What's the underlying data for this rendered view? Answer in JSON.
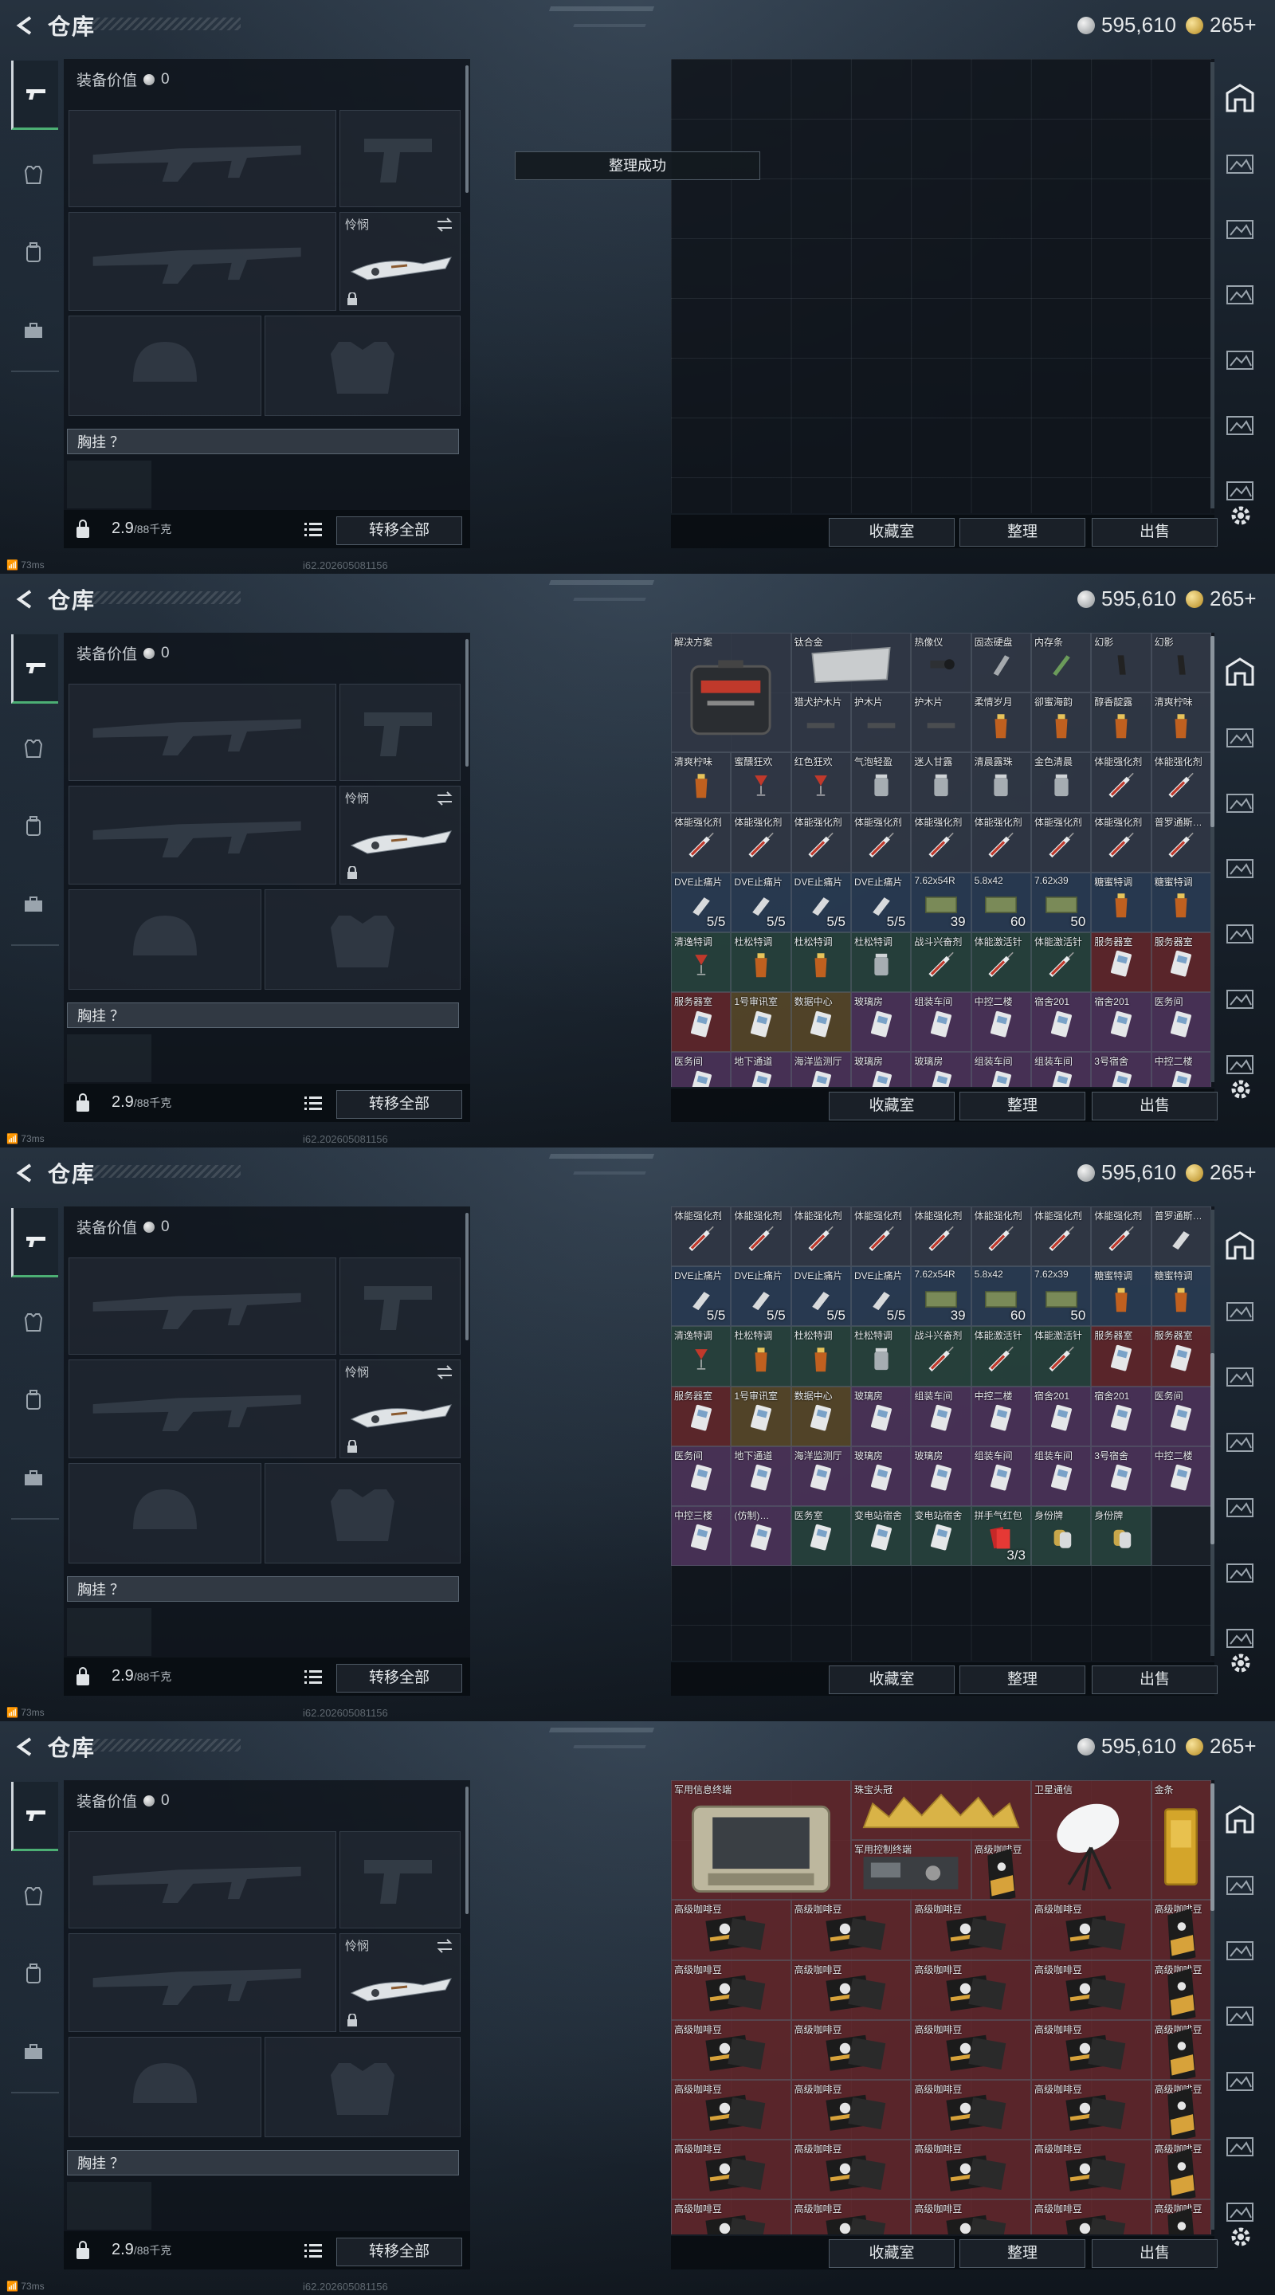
{
  "header": {
    "title": "仓库",
    "silver": "595,610",
    "gold": "265+"
  },
  "equipment": {
    "value_label": "装备价值",
    "value": "0",
    "melee_label": "怜悯",
    "chest_label": "胸挂 ？",
    "weight": "2.9",
    "weight_max": "/88千克",
    "transfer_all": "转移全部"
  },
  "stash_buttons": {
    "collection": "收藏室",
    "sort": "整理",
    "sell": "出售"
  },
  "toast": "整理成功",
  "status": {
    "ping": "73ms",
    "build": "i62.202605081156"
  },
  "colors": {
    "accent_green": "#4caf74",
    "rare_red": "#6e2a2e",
    "panel_dark": "#10151b"
  },
  "left_tab_icons": [
    "gun-icon",
    "armor-icon",
    "backpack-icon",
    "briefcase-icon"
  ],
  "right_tab_icons": [
    "safehouse-icon",
    "stash-tab-icon",
    "stash-tab-icon",
    "stash-tab-icon"
  ],
  "frames": [
    {
      "rows": []
    },
    {
      "rows": [
        [
          {
            "n": "解决方案",
            "c": "n",
            "w": 2,
            "h": 2,
            "i": "case"
          },
          {
            "n": "钛合金",
            "c": "n",
            "w": 2,
            "h": 1,
            "i": "plate"
          },
          {
            "n": "热像仪",
            "c": "n",
            "i": "scope"
          },
          {
            "n": "固态硬盘",
            "c": "n",
            "i": "ssd"
          },
          {
            "n": "内存条",
            "c": "n",
            "i": "ram"
          },
          {
            "n": "幻影",
            "c": "n",
            "i": "mag"
          },
          {
            "n": "幻影",
            "c": "n",
            "i": "mag"
          }
        ],
        [
          {
            "n": "猎犬护木片",
            "c": "n",
            "i": "rail"
          },
          {
            "n": "护木片",
            "c": "n",
            "i": "rail"
          },
          {
            "n": "护木片",
            "c": "n",
            "i": "rail"
          },
          {
            "n": "柔情岁月",
            "c": "n",
            "i": "drink"
          },
          {
            "n": "卻蜜海韵",
            "c": "n",
            "i": "drink"
          },
          {
            "n": "醇香靛露",
            "c": "n",
            "i": "drink"
          },
          {
            "n": "清爽柠味",
            "c": "n",
            "i": "drink"
          }
        ],
        [
          {
            "n": "清爽柠味",
            "c": "n",
            "i": "drink"
          },
          {
            "n": "蜜醺狂欢",
            "c": "n",
            "i": "glass"
          },
          {
            "n": "红色狂欢",
            "c": "n",
            "i": "glass"
          },
          {
            "n": "气泡轻盈",
            "c": "n",
            "i": "jar"
          },
          {
            "n": "迷人甘露",
            "c": "n",
            "i": "jar"
          },
          {
            "n": "清晨露珠",
            "c": "n",
            "i": "jar"
          },
          {
            "n": "金色清晨",
            "c": "n",
            "i": "jar"
          },
          {
            "n": "体能强化剂",
            "c": "n",
            "i": "syringe"
          },
          {
            "n": "体能强化剂",
            "c": "n",
            "i": "syringe"
          }
        ],
        [
          {
            "n": "体能强化剂",
            "c": "n",
            "i": "syringe"
          },
          {
            "n": "体能强化剂",
            "c": "n",
            "i": "syringe"
          },
          {
            "n": "体能强化剂",
            "c": "n",
            "i": "syringe"
          },
          {
            "n": "体能强化剂",
            "c": "n",
            "i": "syringe"
          },
          {
            "n": "体能强化剂",
            "c": "n",
            "i": "syringe"
          },
          {
            "n": "体能强化剂",
            "c": "n",
            "i": "syringe"
          },
          {
            "n": "体能强化剂",
            "c": "n",
            "i": "syringe"
          },
          {
            "n": "体能强化剂",
            "c": "n",
            "i": "syringe"
          },
          {
            "n": "普罗通斯…",
            "c": "n",
            "i": "syringe"
          }
        ],
        [
          {
            "n": "DVE止痛片",
            "c": "b",
            "i": "pill",
            "q": "5/5"
          },
          {
            "n": "DVE止痛片",
            "c": "b",
            "i": "pill",
            "q": "5/5"
          },
          {
            "n": "DVE止痛片",
            "c": "b",
            "i": "pill",
            "q": "5/5"
          },
          {
            "n": "DVE止痛片",
            "c": "b",
            "i": "pill",
            "q": "5/5"
          },
          {
            "n": "7.62x54R",
            "c": "b",
            "i": "ammo",
            "q": "39"
          },
          {
            "n": "5.8x42",
            "c": "b",
            "i": "ammo",
            "q": "60"
          },
          {
            "n": "7.62x39",
            "c": "b",
            "i": "ammo",
            "q": "50"
          },
          {
            "n": "糖蜜特调",
            "c": "b",
            "i": "drink"
          },
          {
            "n": "糖蜜特调",
            "c": "b",
            "i": "drink"
          }
        ],
        [
          {
            "n": "清逸特调",
            "c": "g",
            "i": "glass"
          },
          {
            "n": "杜松特调",
            "c": "g",
            "i": "drink"
          },
          {
            "n": "杜松特调",
            "c": "g",
            "i": "drink"
          },
          {
            "n": "杜松特调",
            "c": "g",
            "i": "jar"
          },
          {
            "n": "战斗兴奋剂",
            "c": "g",
            "i": "syringe"
          },
          {
            "n": "体能激活针",
            "c": "g",
            "i": "syringe"
          },
          {
            "n": "体能激活针",
            "c": "g",
            "i": "syringe"
          },
          {
            "n": "服务器室",
            "c": "r",
            "i": "card"
          },
          {
            "n": "服务器室",
            "c": "r",
            "i": "card"
          }
        ],
        [
          {
            "n": "服务器室",
            "c": "r",
            "i": "card"
          },
          {
            "n": "1号审讯室",
            "c": "y",
            "i": "card"
          },
          {
            "n": "数据中心",
            "c": "y",
            "i": "card"
          },
          {
            "n": "玻璃房",
            "c": "p",
            "i": "card"
          },
          {
            "n": "组装车间",
            "c": "p",
            "i": "card"
          },
          {
            "n": "中控二楼",
            "c": "p",
            "i": "card"
          },
          {
            "n": "宿舍201",
            "c": "p",
            "i": "card"
          },
          {
            "n": "宿舍201",
            "c": "p",
            "i": "card"
          },
          {
            "n": "医务间",
            "c": "p",
            "i": "card"
          }
        ],
        [
          {
            "n": "医务间",
            "c": "p",
            "i": "card"
          },
          {
            "n": "地下通道",
            "c": "p",
            "i": "card"
          },
          {
            "n": "海洋监测厅",
            "c": "p",
            "i": "card"
          },
          {
            "n": "玻璃房",
            "c": "p",
            "i": "card"
          },
          {
            "n": "玻璃房",
            "c": "p",
            "i": "card"
          },
          {
            "n": "组装车间",
            "c": "p",
            "i": "card"
          },
          {
            "n": "组装车间",
            "c": "p",
            "i": "card"
          },
          {
            "n": "3号宿舍",
            "c": "p",
            "i": "card"
          },
          {
            "n": "中控二楼",
            "c": "p",
            "i": "card"
          }
        ]
      ]
    },
    {
      "rows": [
        [
          {
            "n": "体能强化剂",
            "c": "n",
            "i": "syringe"
          },
          {
            "n": "体能强化剂",
            "c": "n",
            "i": "syringe"
          },
          {
            "n": "体能强化剂",
            "c": "n",
            "i": "syringe"
          },
          {
            "n": "体能强化剂",
            "c": "n",
            "i": "syringe"
          },
          {
            "n": "体能强化剂",
            "c": "n",
            "i": "syringe"
          },
          {
            "n": "体能强化剂",
            "c": "n",
            "i": "syringe"
          },
          {
            "n": "体能强化剂",
            "c": "n",
            "i": "syringe"
          },
          {
            "n": "体能强化剂",
            "c": "n",
            "i": "syringe"
          },
          {
            "n": "普罗通斯…",
            "c": "n",
            "i": "pill"
          }
        ],
        [
          {
            "n": "DVE止痛片",
            "c": "b",
            "i": "pill",
            "q": "5/5"
          },
          {
            "n": "DVE止痛片",
            "c": "b",
            "i": "pill",
            "q": "5/5"
          },
          {
            "n": "DVE止痛片",
            "c": "b",
            "i": "pill",
            "q": "5/5"
          },
          {
            "n": "DVE止痛片",
            "c": "b",
            "i": "pill",
            "q": "5/5"
          },
          {
            "n": "7.62x54R",
            "c": "b",
            "i": "ammo",
            "q": "39"
          },
          {
            "n": "5.8x42",
            "c": "b",
            "i": "ammo",
            "q": "60"
          },
          {
            "n": "7.62x39",
            "c": "b",
            "i": "ammo",
            "q": "50"
          },
          {
            "n": "糖蜜特调",
            "c": "b",
            "i": "drink"
          },
          {
            "n": "糖蜜特调",
            "c": "b",
            "i": "drink"
          }
        ],
        [
          {
            "n": "清逸特调",
            "c": "g",
            "i": "glass"
          },
          {
            "n": "杜松特调",
            "c": "g",
            "i": "drink"
          },
          {
            "n": "杜松特调",
            "c": "g",
            "i": "drink"
          },
          {
            "n": "杜松特调",
            "c": "g",
            "i": "jar"
          },
          {
            "n": "战斗兴奋剂",
            "c": "g",
            "i": "syringe"
          },
          {
            "n": "体能激活针",
            "c": "g",
            "i": "syringe"
          },
          {
            "n": "体能激活针",
            "c": "g",
            "i": "syringe"
          },
          {
            "n": "服务器室",
            "c": "r",
            "i": "card"
          },
          {
            "n": "服务器室",
            "c": "r",
            "i": "card"
          }
        ],
        [
          {
            "n": "服务器室",
            "c": "r",
            "i": "card"
          },
          {
            "n": "1号审讯室",
            "c": "y",
            "i": "card"
          },
          {
            "n": "数据中心",
            "c": "y",
            "i": "card"
          },
          {
            "n": "玻璃房",
            "c": "p",
            "i": "card"
          },
          {
            "n": "组装车间",
            "c": "p",
            "i": "card"
          },
          {
            "n": "中控二楼",
            "c": "p",
            "i": "card"
          },
          {
            "n": "宿舍201",
            "c": "p",
            "i": "card"
          },
          {
            "n": "宿舍201",
            "c": "p",
            "i": "card"
          },
          {
            "n": "医务间",
            "c": "p",
            "i": "card"
          }
        ],
        [
          {
            "n": "医务间",
            "c": "p",
            "i": "card"
          },
          {
            "n": "地下通道",
            "c": "p",
            "i": "card"
          },
          {
            "n": "海洋监测厅",
            "c": "p",
            "i": "card"
          },
          {
            "n": "玻璃房",
            "c": "p",
            "i": "card"
          },
          {
            "n": "玻璃房",
            "c": "p",
            "i": "card"
          },
          {
            "n": "组装车间",
            "c": "p",
            "i": "card"
          },
          {
            "n": "组装车间",
            "c": "p",
            "i": "card"
          },
          {
            "n": "3号宿舍",
            "c": "p",
            "i": "card"
          },
          {
            "n": "中控二楼",
            "c": "p",
            "i": "card"
          }
        ],
        [
          {
            "n": "中控三楼",
            "c": "p",
            "i": "card"
          },
          {
            "n": "(仿制)…",
            "c": "p",
            "i": "card"
          },
          {
            "n": "医务室",
            "c": "g",
            "i": "card"
          },
          {
            "n": "变电站宿舍",
            "c": "g",
            "i": "card"
          },
          {
            "n": "变电站宿舍",
            "c": "g",
            "i": "card"
          },
          {
            "n": "拼手气红包",
            "c": "g",
            "i": "redpacket",
            "q": "3/3"
          },
          {
            "n": "身份牌",
            "c": "g",
            "i": "tag"
          },
          {
            "n": "身份牌",
            "c": "g",
            "i": "tag"
          },
          {
            "n": "",
            "c": "e",
            "i": ""
          }
        ],
        [],
        []
      ]
    },
    {
      "rows": [
        [
          {
            "n": "军用信息终端",
            "c": "r",
            "w": 3,
            "h": 2,
            "i": "terminal"
          },
          {
            "n": "珠宝头冠",
            "c": "r",
            "w": 3,
            "h": 1,
            "i": "crown"
          },
          {
            "n": "卫星通信",
            "c": "r",
            "w": 2,
            "h": 2,
            "i": "dish"
          },
          {
            "n": "金条",
            "c": "r",
            "w": 1,
            "h": 2,
            "i": "gold"
          }
        ],
        [
          {
            "n": "军用控制终端",
            "c": "r",
            "w": 2,
            "h": 1,
            "i": "radio"
          },
          {
            "n": "高级咖啡豆",
            "c": "r",
            "w": 1,
            "h": 1,
            "i": "coffee"
          }
        ],
        [
          {
            "n": "高级咖啡豆",
            "c": "r",
            "w": 2,
            "i": "coffee"
          },
          {
            "n": "高级咖啡豆",
            "c": "r",
            "w": 2,
            "i": "coffee"
          },
          {
            "n": "高级咖啡豆",
            "c": "r",
            "w": 2,
            "i": "coffee"
          },
          {
            "n": "高级咖啡豆",
            "c": "r",
            "w": 2,
            "i": "coffee"
          },
          {
            "n": "高级咖啡豆",
            "c": "r",
            "w": 1,
            "i": "coffee"
          }
        ],
        [
          {
            "n": "高级咖啡豆",
            "c": "r",
            "w": 2,
            "i": "coffee"
          },
          {
            "n": "高级咖啡豆",
            "c": "r",
            "w": 2,
            "i": "coffee"
          },
          {
            "n": "高级咖啡豆",
            "c": "r",
            "w": 2,
            "i": "coffee"
          },
          {
            "n": "高级咖啡豆",
            "c": "r",
            "w": 2,
            "i": "coffee"
          },
          {
            "n": "高级咖啡豆",
            "c": "r",
            "w": 1,
            "i": "coffee"
          }
        ],
        [
          {
            "n": "高级咖啡豆",
            "c": "r",
            "w": 2,
            "i": "coffee"
          },
          {
            "n": "高级咖啡豆",
            "c": "r",
            "w": 2,
            "i": "coffee"
          },
          {
            "n": "高级咖啡豆",
            "c": "r",
            "w": 2,
            "i": "coffee"
          },
          {
            "n": "高级咖啡豆",
            "c": "r",
            "w": 2,
            "i": "coffee"
          },
          {
            "n": "高级咖啡豆",
            "c": "r",
            "w": 1,
            "i": "coffee"
          }
        ],
        [
          {
            "n": "高级咖啡豆",
            "c": "r",
            "w": 2,
            "i": "coffee"
          },
          {
            "n": "高级咖啡豆",
            "c": "r",
            "w": 2,
            "i": "coffee"
          },
          {
            "n": "高级咖啡豆",
            "c": "r",
            "w": 2,
            "i": "coffee"
          },
          {
            "n": "高级咖啡豆",
            "c": "r",
            "w": 2,
            "i": "coffee"
          },
          {
            "n": "高级咖啡豆",
            "c": "r",
            "w": 1,
            "i": "coffee"
          }
        ],
        [
          {
            "n": "高级咖啡豆",
            "c": "r",
            "w": 2,
            "i": "coffee"
          },
          {
            "n": "高级咖啡豆",
            "c": "r",
            "w": 2,
            "i": "coffee"
          },
          {
            "n": "高级咖啡豆",
            "c": "r",
            "w": 2,
            "i": "coffee"
          },
          {
            "n": "高级咖啡豆",
            "c": "r",
            "w": 2,
            "i": "coffee"
          },
          {
            "n": "高级咖啡豆",
            "c": "r",
            "w": 1,
            "i": "coffee"
          }
        ],
        [
          {
            "n": "高级咖啡豆",
            "c": "r",
            "w": 2,
            "i": "coffee"
          },
          {
            "n": "高级咖啡豆",
            "c": "r",
            "w": 2,
            "i": "coffee"
          },
          {
            "n": "高级咖啡豆",
            "c": "r",
            "w": 2,
            "i": "coffee"
          },
          {
            "n": "高级咖啡豆",
            "c": "r",
            "w": 2,
            "i": "coffee"
          },
          {
            "n": "高级咖啡豆",
            "c": "r",
            "w": 1,
            "i": "coffee"
          }
        ]
      ]
    }
  ]
}
